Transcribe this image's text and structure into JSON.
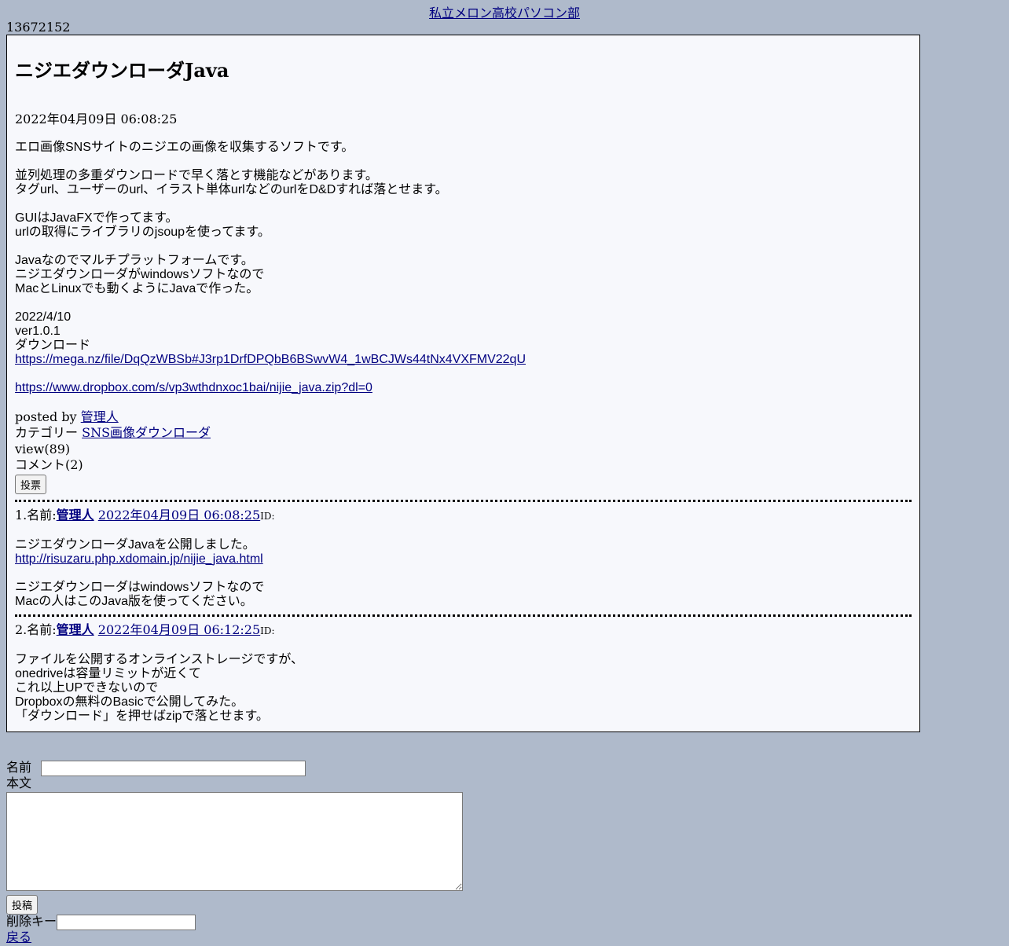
{
  "site": {
    "title": "私立メロン高校パソコン部"
  },
  "counter": "13672152",
  "post": {
    "title": "ニジエダウンローダJava",
    "date": "2022年04月09日 06:08:25",
    "body": {
      "intro": "エロ画像SNSサイトのニジエの画像を収集するソフトです。",
      "feature1": "並列処理の多重ダウンロードで早く落とす機能などがあります。",
      "feature2": "タグurl、ユーザーのurl、イラスト単体urlなどのurlをD&Dすれば落とせます。",
      "gui1": "GUIはJavaFXで作ってます。",
      "gui2": "urlの取得にライブラリのjsoupを使ってます。",
      "java1": "Javaなのでマルチプラットフォームです。",
      "java2": "ニジエダウンローダがwindowsソフトなので",
      "java3": "MacとLinuxでも動くようにJavaで作った。",
      "date_line": "2022/4/10",
      "version": "ver1.0.1",
      "download_label": "ダウンロード",
      "mega_link": "https://mega.nz/file/DqQzWBSb#J3rp1DrfDPQbB6BSwvW4_1wBCJWs44tNx4VXFMV22qU",
      "dropbox_link": "https://www.dropbox.com/s/vp3wthdnxoc1bai/nijie_java.zip?dl=0"
    },
    "meta": {
      "posted_by_label": "posted by",
      "author": "管理人",
      "category_label": "カテゴリー",
      "category": "SNS画像ダウンローダ",
      "views": "view(89)",
      "comments": "コメント(2)",
      "vote_button": "投票"
    }
  },
  "comments": [
    {
      "number": "1.名前:",
      "name": "管理人",
      "date": "2022年04月09日 06:08:25",
      "id_label": "ID:",
      "line1": "ニジエダウンローダJavaを公開しました。",
      "link": "http://risuzaru.php.xdomain.jp/nijie_java.html",
      "line2": "ニジエダウンローダはwindowsソフトなので",
      "line3": "Macの人はこのJava版を使ってください。"
    },
    {
      "number": "2.名前:",
      "name": "管理人",
      "date": "2022年04月09日 06:12:25",
      "id_label": "ID:",
      "line1": "ファイルを公開するオンラインストレージですが、",
      "line2": "onedriveは容量リミットが近くて",
      "line3": "これ以上UPできないので",
      "line4": "Dropboxの無料のBasicで公開してみた。",
      "line5": "「ダウンロード」を押せばzipで落とせます。"
    }
  ],
  "form": {
    "name_label": "名前",
    "name_value": "",
    "body_label": "本文",
    "body_value": "",
    "submit_button": "投稿",
    "delete_key_label": "削除キー",
    "delete_key_value": "",
    "back_link": "戻る"
  }
}
